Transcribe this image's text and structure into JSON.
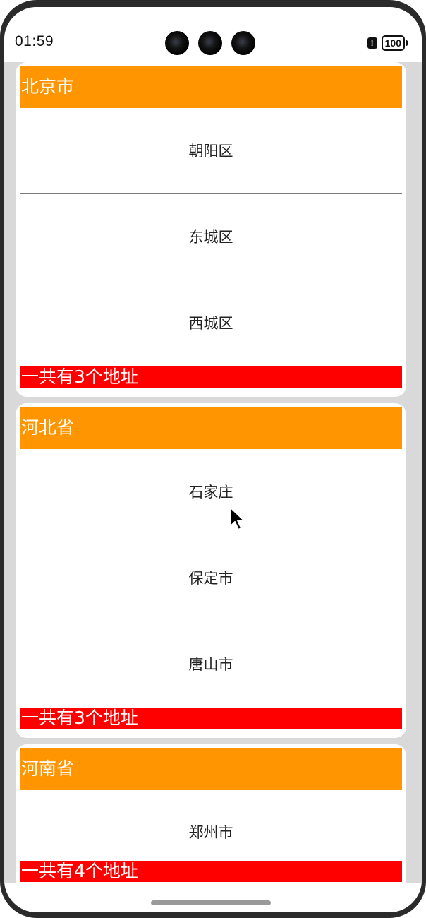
{
  "status_bar": {
    "time": "01:59",
    "battery": "100",
    "alert": "!"
  },
  "groups": [
    {
      "header": "北京市",
      "items": [
        "朝阳区",
        "东城区",
        "西城区"
      ],
      "footer": "一共有3个地址"
    },
    {
      "header": "河北省",
      "items": [
        "石家庄",
        "保定市",
        "唐山市"
      ],
      "footer": "一共有3个地址"
    },
    {
      "header": "河南省",
      "items": [
        "郑州市"
      ],
      "footer": "一共有4个地址"
    }
  ],
  "colors": {
    "header": "#ff9500",
    "footer": "#ff0000",
    "background": "#d9d9d9"
  }
}
